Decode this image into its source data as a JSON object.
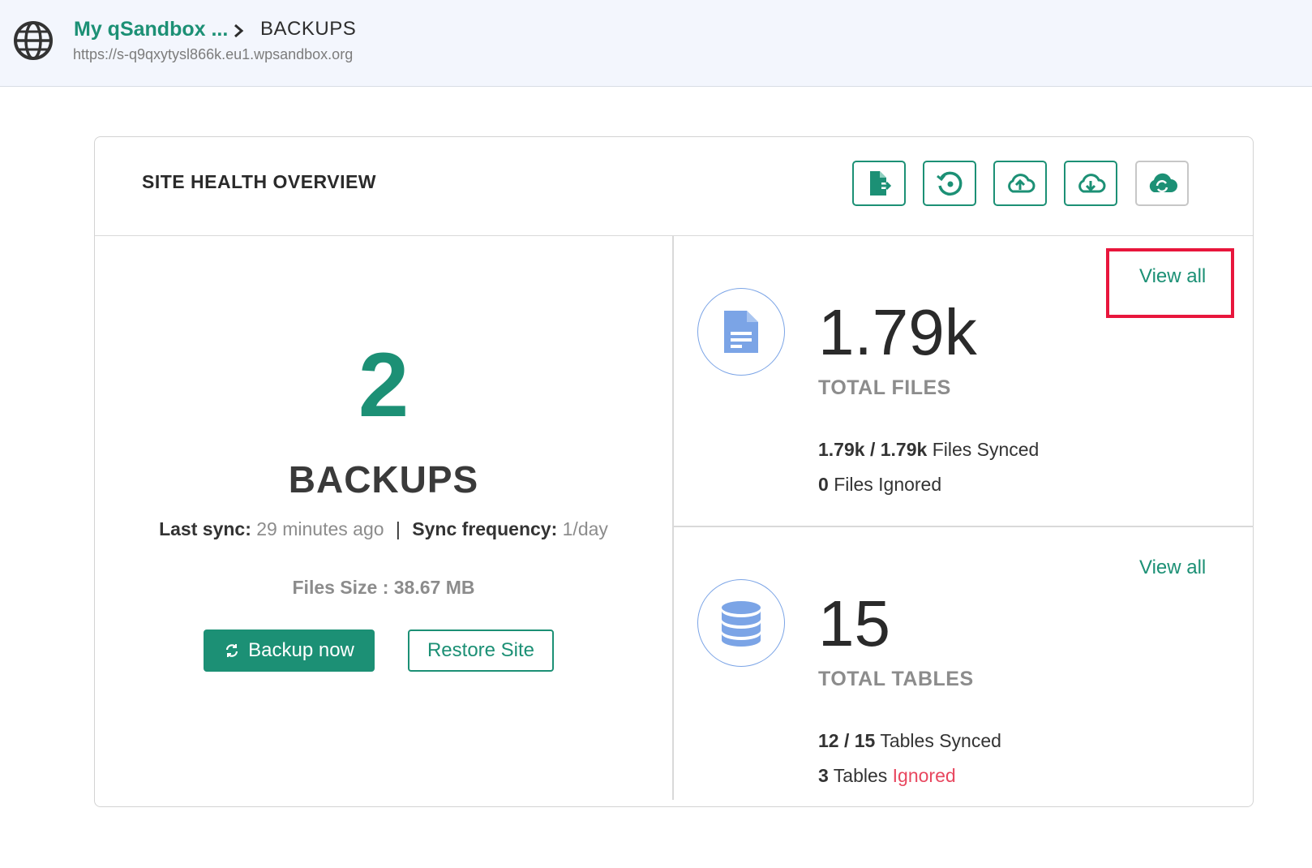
{
  "breadcrumb": {
    "site_name": "My qSandbox ...",
    "page": "BACKUPS",
    "url": "https://s-q9qxytysl866k.eu1.wpsandbox.org"
  },
  "card": {
    "title": "SITE HEALTH OVERVIEW",
    "toolbar": [
      {
        "icon": "file-export-icon"
      },
      {
        "icon": "restore-history-icon"
      },
      {
        "icon": "cloud-upload-icon"
      },
      {
        "icon": "cloud-download-icon"
      },
      {
        "icon": "cloud-sync-icon"
      }
    ]
  },
  "backups": {
    "count": "2",
    "label": "BACKUPS",
    "last_sync_label": "Last sync:",
    "last_sync_value": "29 minutes ago",
    "separator": "|",
    "frequency_label": "Sync frequency:",
    "frequency_value": "1/day",
    "files_size": "Files Size : 38.67 MB",
    "backup_now": "Backup now",
    "restore_site": "Restore Site"
  },
  "files": {
    "view_all": "View all",
    "total": "1.79k",
    "label": "TOTAL FILES",
    "synced_count": "1.79k / 1.79k",
    "synced_text": "Files Synced",
    "ignored_count": "0",
    "ignored_text": "Files Ignored"
  },
  "tables": {
    "view_all": "View all",
    "total": "15",
    "label": "TOTAL TABLES",
    "synced_count": "12 / 15",
    "synced_text": "Tables Synced",
    "ignored_count": "3",
    "ignored_prefix": "Tables",
    "ignored_text": "Ignored"
  },
  "colors": {
    "accent": "#1c9075",
    "icon_blue": "#7ba4e6",
    "danger": "#e8475f",
    "highlight": "#e8163c"
  }
}
